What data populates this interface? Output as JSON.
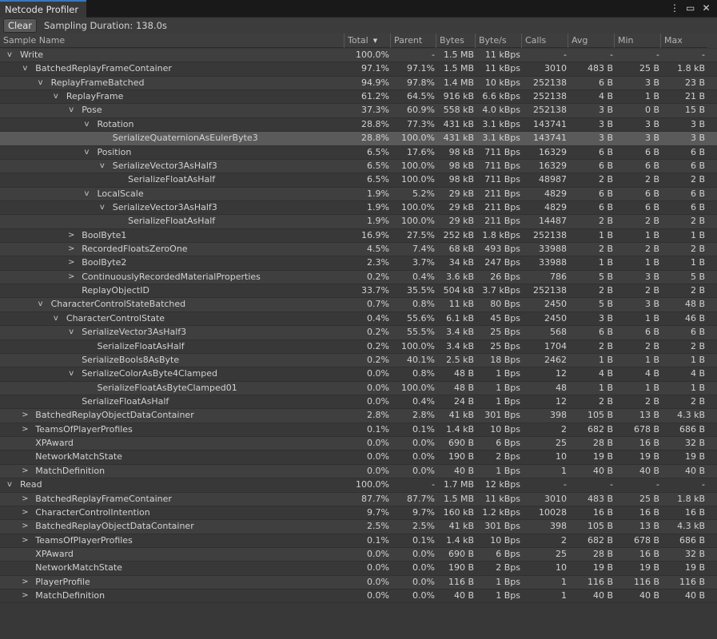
{
  "window": {
    "tab_title": "Netcode Profiler",
    "menu_icon": "kebab-menu-icon",
    "maximize_icon": "maximize-icon",
    "close_icon": "close-icon"
  },
  "toolbar": {
    "clear_label": "Clear",
    "sampling_duration": "Sampling Duration: 138.0s"
  },
  "columns": [
    "Sample Name",
    "Total",
    "Parent",
    "Bytes",
    "Byte/s",
    "Calls",
    "Avg",
    "Min",
    "Max"
  ],
  "sort_column": "Total",
  "rows": [
    {
      "depth": 0,
      "caret": "v",
      "name": "Write",
      "total": "100.0%",
      "parent": "-",
      "bytes": "1.5 MB",
      "bps": "11 kBps",
      "calls": "-",
      "avg": "-",
      "min": "-",
      "max": "-"
    },
    {
      "depth": 1,
      "caret": "v",
      "name": "BatchedReplayFrameContainer",
      "total": "97.1%",
      "parent": "97.1%",
      "bytes": "1.5 MB",
      "bps": "11 kBps",
      "calls": "3010",
      "avg": "483 B",
      "min": "25 B",
      "max": "1.8 kB"
    },
    {
      "depth": 2,
      "caret": "v",
      "name": "ReplayFrameBatched",
      "total": "94.9%",
      "parent": "97.8%",
      "bytes": "1.4 MB",
      "bps": "10 kBps",
      "calls": "252138",
      "avg": "6 B",
      "min": "3 B",
      "max": "23 B"
    },
    {
      "depth": 3,
      "caret": "v",
      "name": "ReplayFrame",
      "total": "61.2%",
      "parent": "64.5%",
      "bytes": "916 kB",
      "bps": "6.6 kBps",
      "calls": "252138",
      "avg": "4 B",
      "min": "1 B",
      "max": "21 B"
    },
    {
      "depth": 4,
      "caret": "v",
      "name": "Pose",
      "total": "37.3%",
      "parent": "60.9%",
      "bytes": "558 kB",
      "bps": "4.0 kBps",
      "calls": "252138",
      "avg": "3 B",
      "min": "0 B",
      "max": "15 B"
    },
    {
      "depth": 5,
      "caret": "v",
      "name": "Rotation",
      "total": "28.8%",
      "parent": "77.3%",
      "bytes": "431 kB",
      "bps": "3.1 kBps",
      "calls": "143741",
      "avg": "3 B",
      "min": "3 B",
      "max": "3 B"
    },
    {
      "depth": 6,
      "caret": "",
      "name": "SerializeQuaternionAsEulerByte3",
      "total": "28.8%",
      "parent": "100.0%",
      "bytes": "431 kB",
      "bps": "3.1 kBps",
      "calls": "143741",
      "avg": "3 B",
      "min": "3 B",
      "max": "3 B",
      "selected": true
    },
    {
      "depth": 5,
      "caret": "v",
      "name": "Position",
      "total": "6.5%",
      "parent": "17.6%",
      "bytes": "98 kB",
      "bps": "711 Bps",
      "calls": "16329",
      "avg": "6 B",
      "min": "6 B",
      "max": "6 B"
    },
    {
      "depth": 6,
      "caret": "v",
      "name": "SerializeVector3AsHalf3",
      "total": "6.5%",
      "parent": "100.0%",
      "bytes": "98 kB",
      "bps": "711 Bps",
      "calls": "16329",
      "avg": "6 B",
      "min": "6 B",
      "max": "6 B"
    },
    {
      "depth": 7,
      "caret": "",
      "name": "SerializeFloatAsHalf",
      "total": "6.5%",
      "parent": "100.0%",
      "bytes": "98 kB",
      "bps": "711 Bps",
      "calls": "48987",
      "avg": "2 B",
      "min": "2 B",
      "max": "2 B"
    },
    {
      "depth": 5,
      "caret": "v",
      "name": "LocalScale",
      "total": "1.9%",
      "parent": "5.2%",
      "bytes": "29 kB",
      "bps": "211 Bps",
      "calls": "4829",
      "avg": "6 B",
      "min": "6 B",
      "max": "6 B"
    },
    {
      "depth": 6,
      "caret": "v",
      "name": "SerializeVector3AsHalf3",
      "total": "1.9%",
      "parent": "100.0%",
      "bytes": "29 kB",
      "bps": "211 Bps",
      "calls": "4829",
      "avg": "6 B",
      "min": "6 B",
      "max": "6 B"
    },
    {
      "depth": 7,
      "caret": "",
      "name": "SerializeFloatAsHalf",
      "total": "1.9%",
      "parent": "100.0%",
      "bytes": "29 kB",
      "bps": "211 Bps",
      "calls": "14487",
      "avg": "2 B",
      "min": "2 B",
      "max": "2 B"
    },
    {
      "depth": 4,
      "caret": ">",
      "name": "BoolByte1",
      "total": "16.9%",
      "parent": "27.5%",
      "bytes": "252 kB",
      "bps": "1.8 kBps",
      "calls": "252138",
      "avg": "1 B",
      "min": "1 B",
      "max": "1 B"
    },
    {
      "depth": 4,
      "caret": ">",
      "name": "RecordedFloatsZeroOne",
      "total": "4.5%",
      "parent": "7.4%",
      "bytes": "68 kB",
      "bps": "493 Bps",
      "calls": "33988",
      "avg": "2 B",
      "min": "2 B",
      "max": "2 B"
    },
    {
      "depth": 4,
      "caret": ">",
      "name": "BoolByte2",
      "total": "2.3%",
      "parent": "3.7%",
      "bytes": "34 kB",
      "bps": "247 Bps",
      "calls": "33988",
      "avg": "1 B",
      "min": "1 B",
      "max": "1 B"
    },
    {
      "depth": 4,
      "caret": ">",
      "name": "ContinuouslyRecordedMaterialProperties",
      "total": "0.2%",
      "parent": "0.4%",
      "bytes": "3.6 kB",
      "bps": "26 Bps",
      "calls": "786",
      "avg": "5 B",
      "min": "3 B",
      "max": "5 B"
    },
    {
      "depth": 4,
      "caret": "",
      "name": "ReplayObjectID",
      "total": "33.7%",
      "parent": "35.5%",
      "bytes": "504 kB",
      "bps": "3.7 kBps",
      "calls": "252138",
      "avg": "2 B",
      "min": "2 B",
      "max": "2 B"
    },
    {
      "depth": 2,
      "caret": "v",
      "name": "CharacterControlStateBatched",
      "total": "0.7%",
      "parent": "0.8%",
      "bytes": "11 kB",
      "bps": "80 Bps",
      "calls": "2450",
      "avg": "5 B",
      "min": "3 B",
      "max": "48 B"
    },
    {
      "depth": 3,
      "caret": "v",
      "name": "CharacterControlState",
      "total": "0.4%",
      "parent": "55.6%",
      "bytes": "6.1 kB",
      "bps": "45 Bps",
      "calls": "2450",
      "avg": "3 B",
      "min": "1 B",
      "max": "46 B"
    },
    {
      "depth": 4,
      "caret": "v",
      "name": "SerializeVector3AsHalf3",
      "total": "0.2%",
      "parent": "55.5%",
      "bytes": "3.4 kB",
      "bps": "25 Bps",
      "calls": "568",
      "avg": "6 B",
      "min": "6 B",
      "max": "6 B"
    },
    {
      "depth": 5,
      "caret": "",
      "name": "SerializeFloatAsHalf",
      "total": "0.2%",
      "parent": "100.0%",
      "bytes": "3.4 kB",
      "bps": "25 Bps",
      "calls": "1704",
      "avg": "2 B",
      "min": "2 B",
      "max": "2 B"
    },
    {
      "depth": 4,
      "caret": "",
      "name": "SerializeBools8AsByte",
      "total": "0.2%",
      "parent": "40.1%",
      "bytes": "2.5 kB",
      "bps": "18 Bps",
      "calls": "2462",
      "avg": "1 B",
      "min": "1 B",
      "max": "1 B"
    },
    {
      "depth": 4,
      "caret": "v",
      "name": "SerializeColorAsByte4Clamped",
      "total": "0.0%",
      "parent": "0.8%",
      "bytes": "48 B",
      "bps": "1 Bps",
      "calls": "12",
      "avg": "4 B",
      "min": "4 B",
      "max": "4 B"
    },
    {
      "depth": 5,
      "caret": "",
      "name": "SerializeFloatAsByteClamped01",
      "total": "0.0%",
      "parent": "100.0%",
      "bytes": "48 B",
      "bps": "1 Bps",
      "calls": "48",
      "avg": "1 B",
      "min": "1 B",
      "max": "1 B"
    },
    {
      "depth": 4,
      "caret": "",
      "name": "SerializeFloatAsHalf",
      "total": "0.0%",
      "parent": "0.4%",
      "bytes": "24 B",
      "bps": "1 Bps",
      "calls": "12",
      "avg": "2 B",
      "min": "2 B",
      "max": "2 B"
    },
    {
      "depth": 1,
      "caret": ">",
      "name": "BatchedReplayObjectDataContainer",
      "total": "2.8%",
      "parent": "2.8%",
      "bytes": "41 kB",
      "bps": "301 Bps",
      "calls": "398",
      "avg": "105 B",
      "min": "13 B",
      "max": "4.3 kB"
    },
    {
      "depth": 1,
      "caret": ">",
      "name": "TeamsOfPlayerProfiles",
      "total": "0.1%",
      "parent": "0.1%",
      "bytes": "1.4 kB",
      "bps": "10 Bps",
      "calls": "2",
      "avg": "682 B",
      "min": "678 B",
      "max": "686 B"
    },
    {
      "depth": 1,
      "caret": "",
      "name": "XPAward",
      "total": "0.0%",
      "parent": "0.0%",
      "bytes": "690 B",
      "bps": "6 Bps",
      "calls": "25",
      "avg": "28 B",
      "min": "16 B",
      "max": "32 B"
    },
    {
      "depth": 1,
      "caret": "",
      "name": "NetworkMatchState",
      "total": "0.0%",
      "parent": "0.0%",
      "bytes": "190 B",
      "bps": "2 Bps",
      "calls": "10",
      "avg": "19 B",
      "min": "19 B",
      "max": "19 B"
    },
    {
      "depth": 1,
      "caret": ">",
      "name": "MatchDefinition",
      "total": "0.0%",
      "parent": "0.0%",
      "bytes": "40 B",
      "bps": "1 Bps",
      "calls": "1",
      "avg": "40 B",
      "min": "40 B",
      "max": "40 B"
    },
    {
      "depth": 0,
      "caret": "v",
      "name": "Read",
      "total": "100.0%",
      "parent": "-",
      "bytes": "1.7 MB",
      "bps": "12 kBps",
      "calls": "-",
      "avg": "-",
      "min": "-",
      "max": "-"
    },
    {
      "depth": 1,
      "caret": ">",
      "name": "BatchedReplayFrameContainer",
      "total": "87.7%",
      "parent": "87.7%",
      "bytes": "1.5 MB",
      "bps": "11 kBps",
      "calls": "3010",
      "avg": "483 B",
      "min": "25 B",
      "max": "1.8 kB"
    },
    {
      "depth": 1,
      "caret": ">",
      "name": "CharacterControlIntention",
      "total": "9.7%",
      "parent": "9.7%",
      "bytes": "160 kB",
      "bps": "1.2 kBps",
      "calls": "10028",
      "avg": "16 B",
      "min": "16 B",
      "max": "16 B"
    },
    {
      "depth": 1,
      "caret": ">",
      "name": "BatchedReplayObjectDataContainer",
      "total": "2.5%",
      "parent": "2.5%",
      "bytes": "41 kB",
      "bps": "301 Bps",
      "calls": "398",
      "avg": "105 B",
      "min": "13 B",
      "max": "4.3 kB"
    },
    {
      "depth": 1,
      "caret": ">",
      "name": "TeamsOfPlayerProfiles",
      "total": "0.1%",
      "parent": "0.1%",
      "bytes": "1.4 kB",
      "bps": "10 Bps",
      "calls": "2",
      "avg": "682 B",
      "min": "678 B",
      "max": "686 B"
    },
    {
      "depth": 1,
      "caret": "",
      "name": "XPAward",
      "total": "0.0%",
      "parent": "0.0%",
      "bytes": "690 B",
      "bps": "6 Bps",
      "calls": "25",
      "avg": "28 B",
      "min": "16 B",
      "max": "32 B"
    },
    {
      "depth": 1,
      "caret": "",
      "name": "NetworkMatchState",
      "total": "0.0%",
      "parent": "0.0%",
      "bytes": "190 B",
      "bps": "2 Bps",
      "calls": "10",
      "avg": "19 B",
      "min": "19 B",
      "max": "19 B"
    },
    {
      "depth": 1,
      "caret": ">",
      "name": "PlayerProfile",
      "total": "0.0%",
      "parent": "0.0%",
      "bytes": "116 B",
      "bps": "1 Bps",
      "calls": "1",
      "avg": "116 B",
      "min": "116 B",
      "max": "116 B"
    },
    {
      "depth": 1,
      "caret": ">",
      "name": "MatchDefinition",
      "total": "0.0%",
      "parent": "0.0%",
      "bytes": "40 B",
      "bps": "1 Bps",
      "calls": "1",
      "avg": "40 B",
      "min": "40 B",
      "max": "40 B"
    }
  ]
}
